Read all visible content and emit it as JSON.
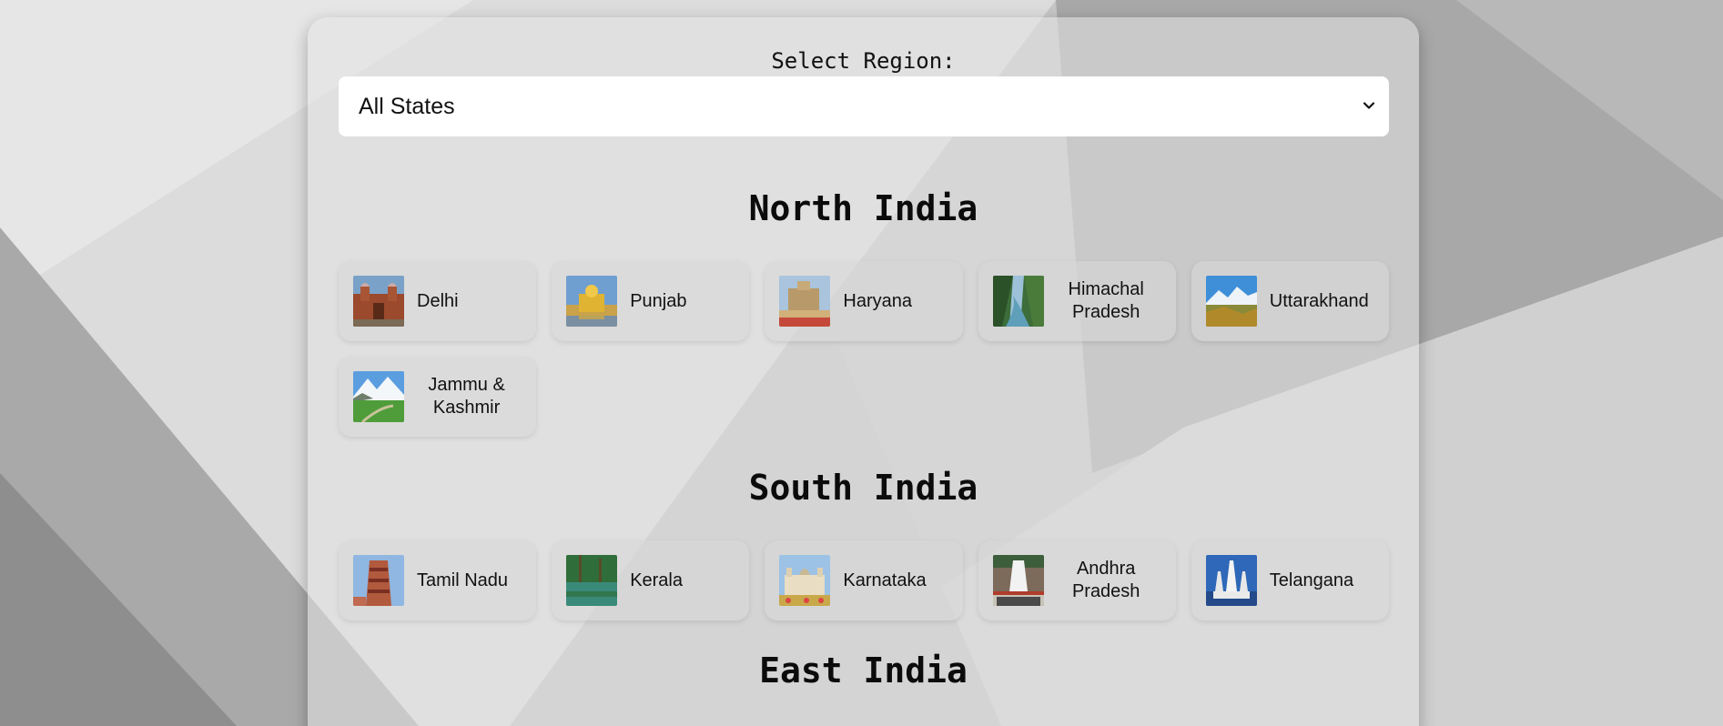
{
  "region_select": {
    "label": "Select Region:",
    "value": "All States"
  },
  "sections": {
    "north": {
      "title": "North India",
      "states": [
        {
          "name": "Delhi",
          "image": "red-fort-image"
        },
        {
          "name": "Punjab",
          "image": "golden-temple-image"
        },
        {
          "name": "Haryana",
          "image": "haryana-monument-image"
        },
        {
          "name": "Himachal Pradesh",
          "image": "himachal-valley-image"
        },
        {
          "name": "Uttarakhand",
          "image": "uttarakhand-mountains-image"
        },
        {
          "name": "Jammu & Kashmir",
          "image": "kashmir-meadow-image"
        }
      ]
    },
    "south": {
      "title": "South India",
      "states": [
        {
          "name": "Tamil Nadu",
          "image": "temple-gopuram-image"
        },
        {
          "name": "Kerala",
          "image": "kerala-backwaters-image"
        },
        {
          "name": "Karnataka",
          "image": "mysore-palace-image"
        },
        {
          "name": "Andhra Pradesh",
          "image": "tirupati-temple-image"
        },
        {
          "name": "Telangana",
          "image": "birla-mandir-image"
        }
      ]
    },
    "east": {
      "title": "East India"
    }
  }
}
